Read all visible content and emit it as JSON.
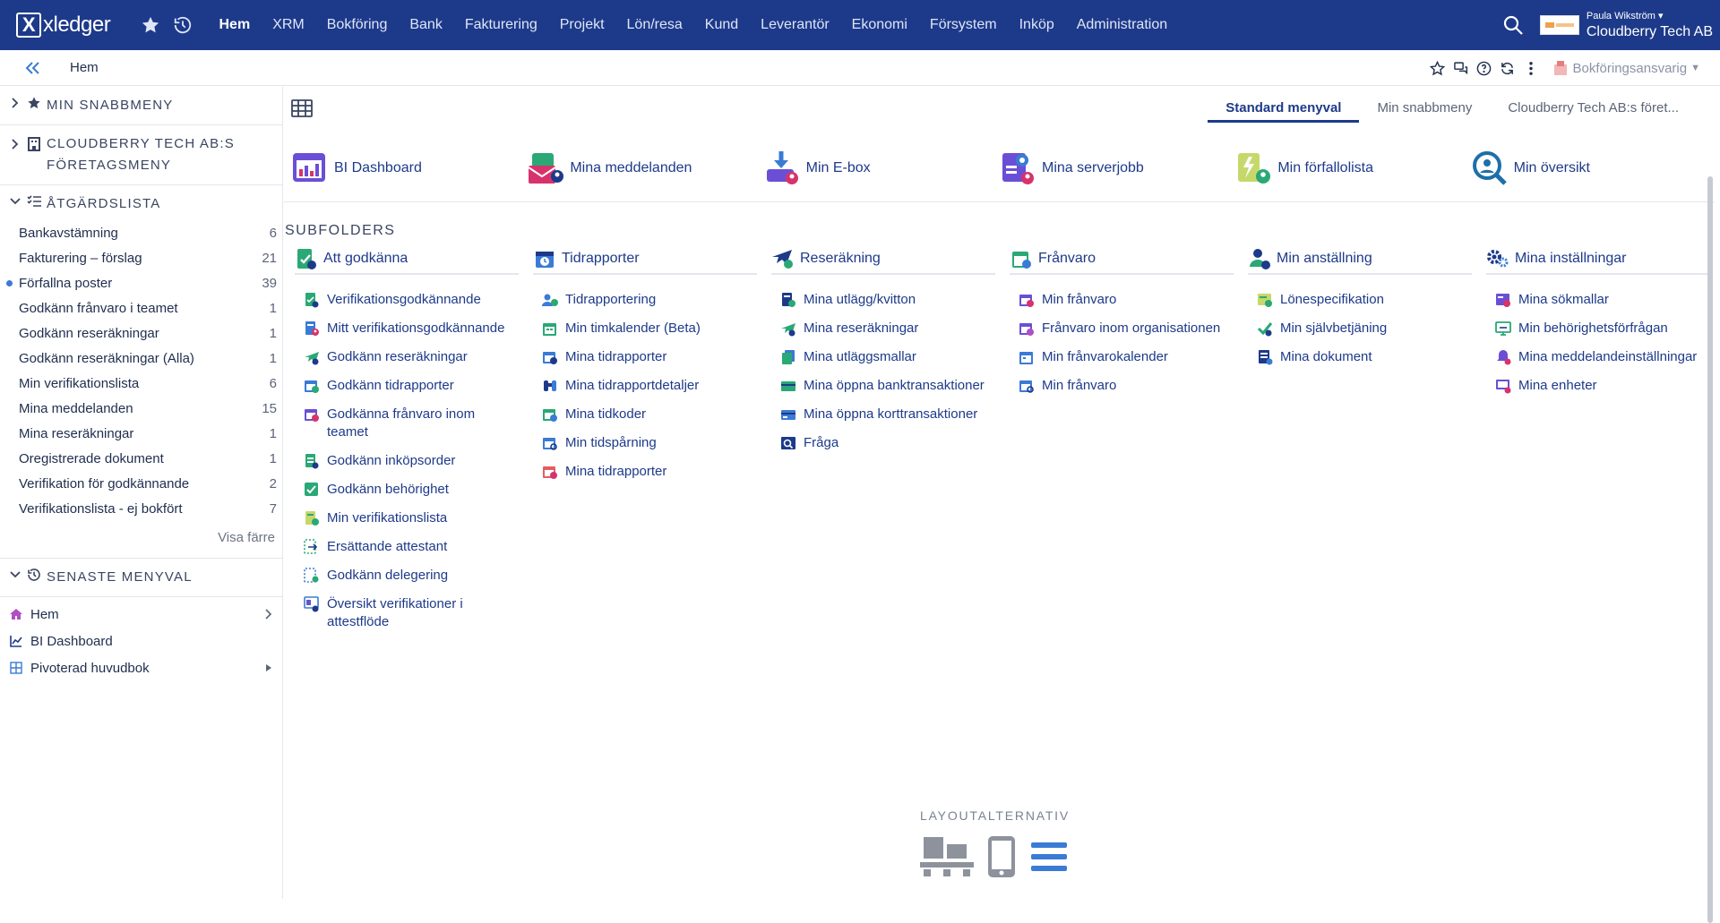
{
  "app": {
    "logo_text": "xledger",
    "nav": [
      "Hem",
      "XRM",
      "Bokföring",
      "Bank",
      "Fakturering",
      "Projekt",
      "Lön/resa",
      "Kund",
      "Leverantör",
      "Ekonomi",
      "Försystem",
      "Inköp",
      "Administration"
    ],
    "active_nav": "Hem",
    "user_name": "Paula Wikström",
    "company": "Cloudberry Tech AB"
  },
  "subbar": {
    "breadcrumb": "Hem",
    "role": "Bokföringsansvarig"
  },
  "sidebar": {
    "snabbmeny_title": "MIN SNABBMENY",
    "foretagsmeny_title": "CLOUDBERRY TECH AB:S FÖRETAGSMENY",
    "atgardslista_title": "ÅTGÄRDSLISTA",
    "actions": [
      {
        "label": "Bankavstämning",
        "count": "6"
      },
      {
        "label": "Fakturering – förslag",
        "count": "21"
      },
      {
        "label": "Förfallna poster",
        "count": "39"
      },
      {
        "label": "Godkänn frånvaro i teamet",
        "count": "1"
      },
      {
        "label": "Godkänn reseräkningar",
        "count": "1"
      },
      {
        "label": "Godkänn reseräkningar (Alla)",
        "count": "1"
      },
      {
        "label": "Min verifikationslista",
        "count": "6"
      },
      {
        "label": "Mina meddelanden",
        "count": "15"
      },
      {
        "label": "Mina reseräkningar",
        "count": "1"
      },
      {
        "label": "Oregistrerade dokument",
        "count": "1"
      },
      {
        "label": "Verifikation för godkännande",
        "count": "2"
      },
      {
        "label": "Verifikationslista - ej bokfört",
        "count": "7"
      }
    ],
    "show_less": "Visa färre",
    "recent_title": "SENASTE MENYVAL",
    "recent": [
      "Hem",
      "BI Dashboard",
      "Pivoterad huvudbok"
    ]
  },
  "main": {
    "tabs": [
      "Standard menyval",
      "Min snabbmeny",
      "Cloudberry Tech AB:s föret..."
    ],
    "quick": [
      "BI Dashboard",
      "Mina meddelanden",
      "Min E-box",
      "Mina serverjobb",
      "Min förfallolista",
      "Min översikt"
    ],
    "subfolders_title": "SUBFOLDERS",
    "folders": [
      {
        "title": "Att godkänna",
        "items": [
          "Verifikationsgodkännande",
          "Mitt verifikationsgodkännande",
          "Godkänn reseräkningar",
          "Godkänn tidrapporter",
          "Godkänna frånvaro inom teamet",
          "Godkänn inköpsorder",
          "Godkänn behörighet",
          "Min verifikationslista",
          "Ersättande attestant",
          "Godkänn delegering",
          "Översikt verifikationer i attestflöde"
        ]
      },
      {
        "title": "Tidrapporter",
        "items": [
          "Tidrapportering",
          "Min timkalender (Beta)",
          "Mina tidrapporter",
          "Mina tidrapportdetaljer",
          "Mina tidkoder",
          "Min tidspårning",
          "Mina tidrapporter"
        ]
      },
      {
        "title": "Reseräkning",
        "items": [
          "Mina utlägg/kvitton",
          "Mina reseräkningar",
          "Mina utläggsmallar",
          "Mina öppna banktransaktioner",
          "Mina öppna korttransaktioner",
          "Fråga"
        ]
      },
      {
        "title": "Frånvaro",
        "items": [
          "Min frånvaro",
          "Frånvaro inom organisationen",
          "Min frånvarokalender",
          "Min frånvaro"
        ]
      },
      {
        "title": "Min anställning",
        "items": [
          "Lönespecifikation",
          "Min självbetjäning",
          "Mina dokument"
        ]
      },
      {
        "title": "Mina inställningar",
        "items": [
          "Mina sökmallar",
          "Min behörighetsförfrågan",
          "Mina meddelandeinställningar",
          "Mina enheter"
        ]
      }
    ],
    "layout_title": "LAYOUTALTERNATIV"
  },
  "colors": {
    "nav_bg": "#1d3a8a",
    "link": "#1d3a8a",
    "accent_blue": "#3a7bd5",
    "accent_green": "#2aa876",
    "accent_pink": "#d6336c"
  }
}
